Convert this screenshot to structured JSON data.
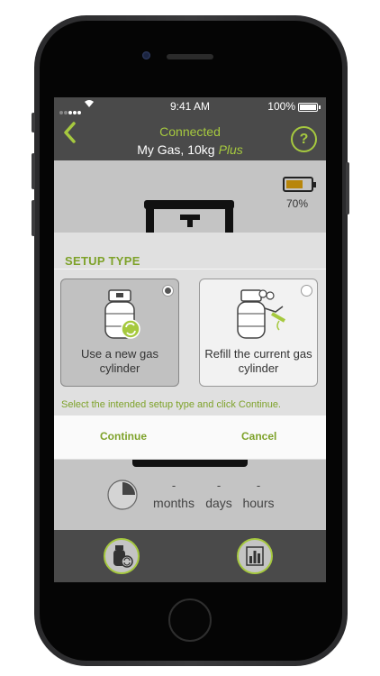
{
  "status_bar": {
    "time": "9:41 AM",
    "battery_percent": "100%"
  },
  "nav": {
    "connection_status": "Connected",
    "device_name": "My Gas, 10kg",
    "device_tier": "Plus"
  },
  "gauge": {
    "battery_level": "70%"
  },
  "setup_modal": {
    "title": "SETUP TYPE",
    "options": [
      {
        "label": "Use a new gas cylinder",
        "selected": true,
        "icon": "new-cylinder-icon"
      },
      {
        "label": "Refill the current gas cylinder",
        "selected": false,
        "icon": "refill-cylinder-icon"
      }
    ],
    "hint": "Select the intended setup type and click Continue.",
    "continue_label": "Continue",
    "cancel_label": "Cancel"
  },
  "time_remaining": {
    "months_value": "-",
    "months_label": "months",
    "days_value": "-",
    "days_label": "days",
    "hours_value": "-",
    "hours_label": "hours"
  },
  "tabs": [
    {
      "icon": "cylinder-swap-icon"
    },
    {
      "icon": "bar-chart-icon"
    }
  ],
  "colors": {
    "accent": "#a6c93f",
    "bar": "#4a4a4a",
    "screen_bg": "#c4c4c4"
  }
}
